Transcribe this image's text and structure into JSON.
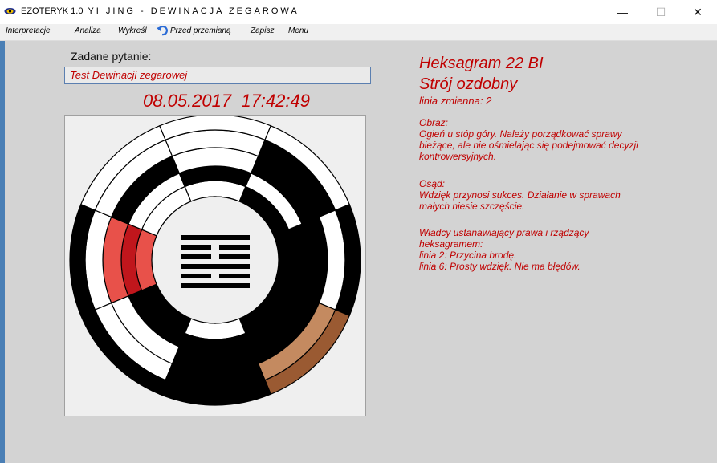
{
  "window": {
    "app_name": "EZOTERYK 1.0",
    "subtitle": "YI JING - DEWINACJA ZEGAROWA",
    "minimize_glyph": "—",
    "maximize_glyph": "☐",
    "close_glyph": "✕"
  },
  "menu": {
    "items": [
      "Interpretacje",
      "Analiza",
      "Wykreśl",
      "Przed przemianą",
      "Zapisz",
      "Menu"
    ],
    "undo_icon": "undo-arrow-icon"
  },
  "question": {
    "label": "Zadane pytanie:",
    "value": "Test Dewinacji zegarowej"
  },
  "datetime": "08.05.2017  17:42:49",
  "colors": {
    "accent_text": "#c00000",
    "highlight_red_light": "#e8514a",
    "highlight_red_dark": "#c0161c",
    "highlight_brown_dark": "#9a5a32",
    "highlight_brown_light": "#c48a60",
    "window_accent": "#4a7fb5"
  },
  "chart_data": {
    "type": "diagram",
    "rings": 5,
    "sectors": 8,
    "center_hexagram_lines": [
      "solid",
      "broken",
      "broken",
      "solid",
      "broken",
      "solid"
    ],
    "highlighted_sectors": [
      {
        "sector": "left",
        "color": "red"
      },
      {
        "sector": "lower-right",
        "color": "brown"
      }
    ]
  },
  "result": {
    "hexagram_title": "Heksagram 22 BI",
    "hexagram_name": "Strój ozdobny",
    "changing_line": "linia zmienna: 2",
    "image_label": "Obraz:",
    "image_text": [
      "Ogień u stóp góry. Należy porządkować sprawy",
      "bieżące, ale nie ośmielając się podejmować decyzji",
      "kontrowersyjnych."
    ],
    "judgement_label": "Osąd:",
    "judgement_text": [
      "Wdzięk przynosi sukces. Działanie w sprawach",
      "małych niesie szczęście."
    ],
    "rulers_text": [
      "Władcy ustanawiający prawa i rządzący",
      "heksagramem:",
      "linia 2: Przycina brodę.",
      "linia 6: Prosty wdzięk. Nie ma błędów."
    ]
  }
}
